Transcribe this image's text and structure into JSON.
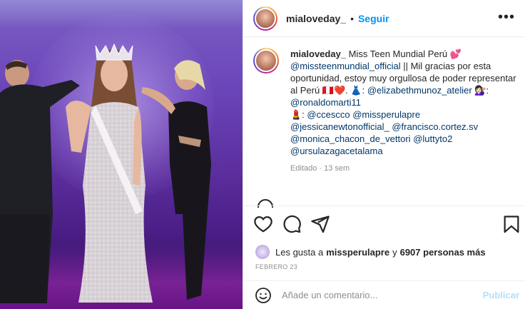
{
  "header": {
    "username": "mialoveday_",
    "separator": "•",
    "follow_label": "Seguir",
    "more_icon": "more-horizontal-icon"
  },
  "caption": {
    "username": "mialoveday_",
    "line1": " Miss Teen Mundial Perú 💕",
    "mention1": "@missteenmundial_official",
    "text1": " || Mil gracias por esta oportunidad, estoy muy orgullosa de poder representar al Perú 🇵🇪❤️. 👗: ",
    "mention2": "@elizabethmunoz_atelier",
    "text2": " 💇🏻‍♀️: ",
    "mention3": "@ronaldomarti11",
    "text3": " 💄: ",
    "mention4": "@ccescco",
    "mention5": "@missperulapre",
    "mention6": "@jessicanewtonofficial_",
    "mention7": "@francisco.cortez.sv",
    "mention8": "@monica_chacon_de_vettori",
    "mention9": "@luttyto2",
    "mention10": "@ursulazagacetalama",
    "meta": "Editado · 13 sem"
  },
  "likes": {
    "prefix": "Les gusta a",
    "user": "missperulapre",
    "middle": "y",
    "count": "6907 personas más"
  },
  "date": "FEBRERO 23",
  "comment": {
    "placeholder": "Añade un comentario...",
    "post_label": "Publicar"
  },
  "colors": {
    "accent": "#0095f6",
    "mention": "#00376b",
    "muted": "#8e8e8e"
  }
}
